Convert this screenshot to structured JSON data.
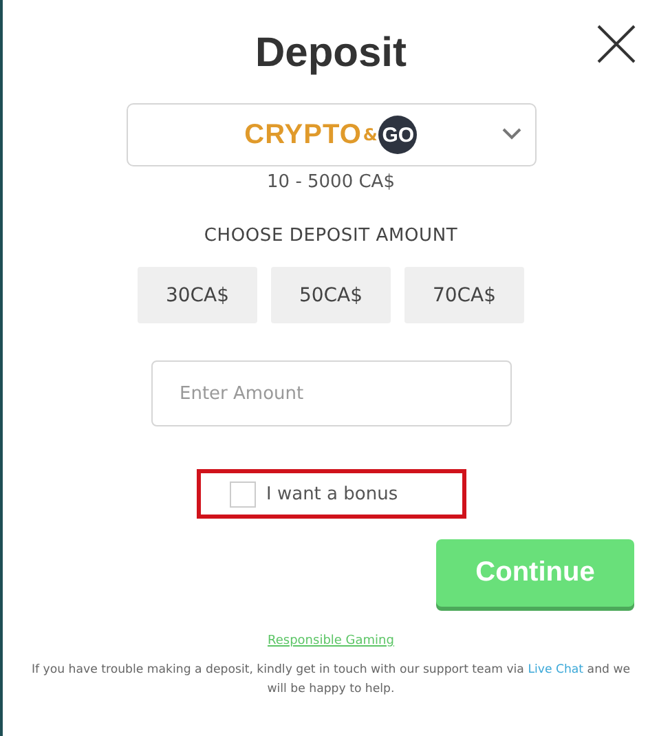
{
  "title": "Deposit",
  "payment_method": {
    "logo": {
      "word": "CRYPTO",
      "ampersand": "&",
      "badge": "GO"
    },
    "expanded": false
  },
  "range": "10 - 5000 CA$",
  "amount_heading": "CHOOSE DEPOSIT AMOUNT",
  "amounts": [
    {
      "label": "30CA$",
      "selected": false
    },
    {
      "label": "50CA$",
      "selected": false
    },
    {
      "label": "70CA$",
      "selected": false
    }
  ],
  "amount_field": {
    "placeholder": "Enter Amount"
  },
  "bonus": {
    "label": "I want a bonus",
    "checked": false,
    "highlighted": true
  },
  "continue_button": "Continue",
  "responsible_link": "Responsible Gaming",
  "help": {
    "text": "If you have trouble making a deposit, kindly get in touch with our support team via",
    "link": "Live Chat",
    "after": "and we will be happy to help."
  }
}
